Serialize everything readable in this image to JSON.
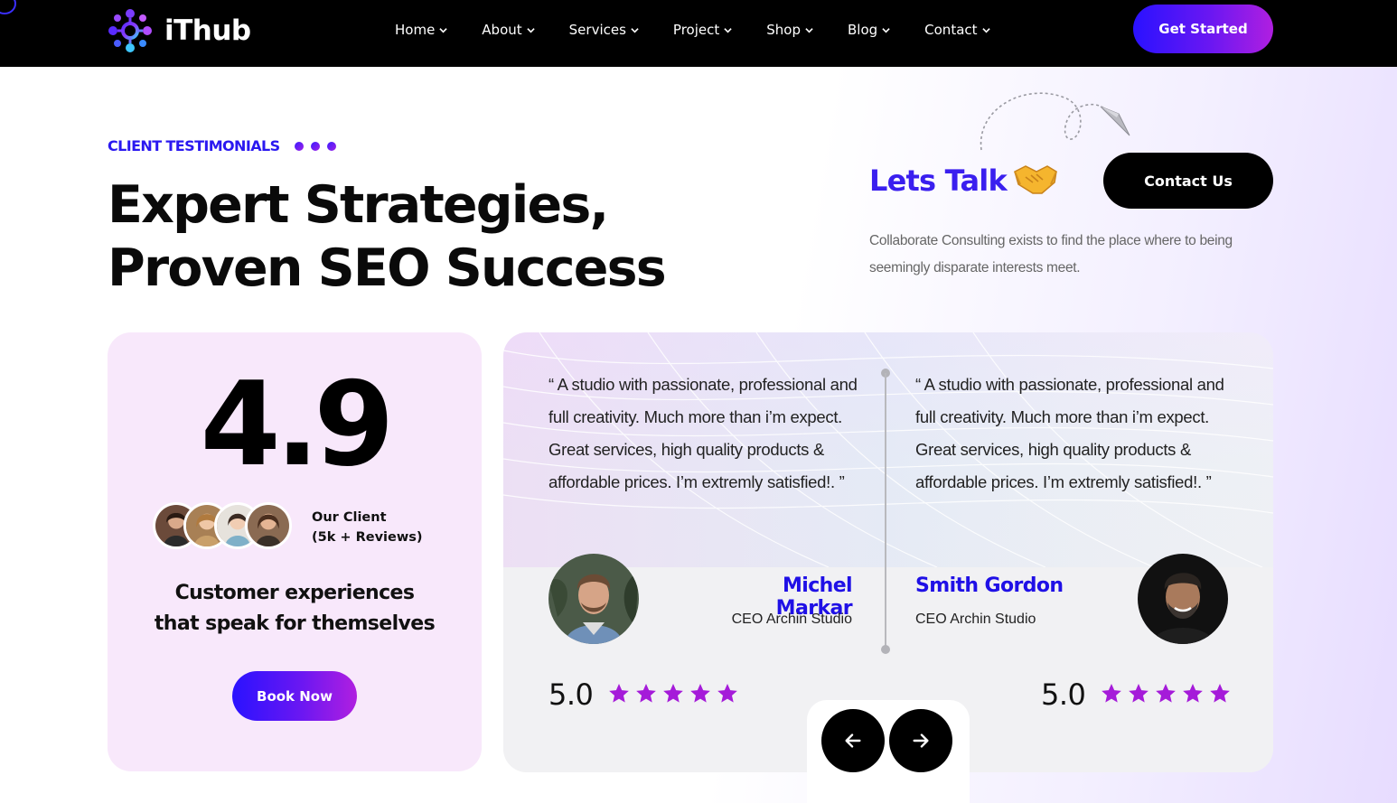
{
  "brand": {
    "name": "iThub"
  },
  "nav": [
    {
      "label": "Home"
    },
    {
      "label": "About"
    },
    {
      "label": "Services"
    },
    {
      "label": "Project"
    },
    {
      "label": "Shop"
    },
    {
      "label": "Blog"
    },
    {
      "label": "Contact"
    }
  ],
  "header": {
    "cta_label": "Get Started"
  },
  "hero": {
    "eyebrow": "CLIENT TESTIMONIALS",
    "headline_line1": "Expert Strategies,",
    "headline_line2": "Proven SEO Success"
  },
  "talk": {
    "title": "Lets Talk",
    "contact_label": "Contact Us",
    "description": "Collaborate Consulting exists to find the place where to being seemingly disparate interests meet."
  },
  "rating_card": {
    "rating": "4.9",
    "client_line1": "Our Client",
    "client_line2": "(5k + Reviews)",
    "tagline_line1": "Customer experiences",
    "tagline_line2": "that speak for themselves",
    "book_label": "Book Now"
  },
  "testimonials": [
    {
      "quote": "“ A studio with passionate, professional and full creativity. Much more than i’m expect. Great services, high quality products & affordable prices. I’m extremly satisfied!. ”",
      "name": "Michel Markar",
      "role": "CEO Archin Studio",
      "score": "5.0",
      "stars": 5
    },
    {
      "quote": "“ A studio with passionate, professional and full creativity. Much more than i’m expect. Great services, high quality products & affordable prices. I’m extremly satisfied!. ”",
      "name": "Smith Gordon",
      "role": "CEO Archin Studio",
      "score": "5.0",
      "stars": 5
    }
  ],
  "colors": {
    "accent_blue": "#2a18f0",
    "accent_purple": "#b01fe0",
    "star": "#a51bd9",
    "card_pink": "#f8e8fb"
  }
}
